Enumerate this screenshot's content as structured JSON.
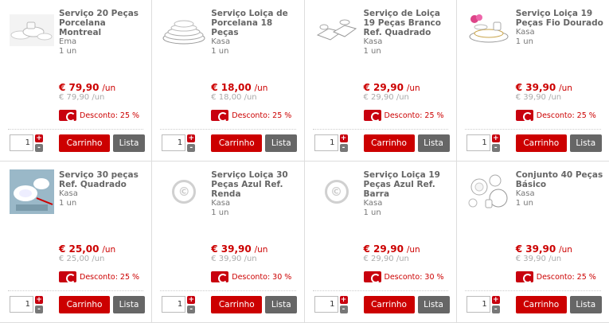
{
  "products": [
    {
      "name": "Serviço 20 Peças Porcelana Montreal",
      "brand": "Ema",
      "unit": "1 un",
      "price": "€ 79,90",
      "price_unit": "/un",
      "old_price": "€ 79,90 /un",
      "discount": "Desconto: 25 %",
      "qty": "1",
      "cart_label": "Carrinho",
      "list_label": "Lista",
      "image": "dish-set"
    },
    {
      "name": "Serviço Loiça de Porcelana 18 Peças",
      "brand": "Kasa",
      "unit": "1 un",
      "price": "€ 18,00",
      "price_unit": "/un",
      "old_price": "€ 18,00 /un",
      "discount": "Desconto: 25 %",
      "qty": "1",
      "cart_label": "Carrinho",
      "list_label": "Lista",
      "image": "plate-stack"
    },
    {
      "name": "Serviço de Loiça 19 Peças Branco Ref. Quadrado",
      "brand": "Kasa",
      "unit": "1 un",
      "price": "€ 29,90",
      "price_unit": "/un",
      "old_price": "€ 29,90 /un",
      "discount": "Desconto: 25 %",
      "qty": "1",
      "cart_label": "Carrinho",
      "list_label": "Lista",
      "image": "square-dishes"
    },
    {
      "name": "Serviço Loiça 19 Peças Fio Dourado",
      "brand": "Kasa",
      "unit": "1 un",
      "price": "€ 39,90",
      "price_unit": "/un",
      "old_price": "€ 39,90 /un",
      "discount": "Desconto: 25 %",
      "qty": "1",
      "cart_label": "Carrinho",
      "list_label": "Lista",
      "image": "gold-dishes"
    },
    {
      "name": "Serviço 30 peças Ref. Quadrado",
      "brand": "Kasa",
      "unit": "1 un",
      "price": "€ 25,00",
      "price_unit": "/un",
      "old_price": "€ 25,00 /un",
      "discount": "Desconto: 25 %",
      "qty": "1",
      "cart_label": "Carrinho",
      "list_label": "Lista",
      "image": "blue-table"
    },
    {
      "name": "Serviço Loiça 30 Peças Azul Ref. Renda",
      "brand": "Kasa",
      "unit": "1 un",
      "price": "€ 39,90",
      "price_unit": "/un",
      "old_price": "€ 39,90 /un",
      "discount": "Desconto: 30 %",
      "qty": "1",
      "cart_label": "Carrinho",
      "list_label": "Lista",
      "image": "placeholder"
    },
    {
      "name": "Serviço Loiça 19 Peças Azul Ref. Barra",
      "brand": "Kasa",
      "unit": "1 un",
      "price": "€ 29,90",
      "price_unit": "/un",
      "old_price": "€ 29,90 /un",
      "discount": "Desconto: 30 %",
      "qty": "1",
      "cart_label": "Carrinho",
      "list_label": "Lista",
      "image": "placeholder"
    },
    {
      "name": "Conjunto 40 Peças Básico",
      "brand": "Kasa",
      "unit": "1 un",
      "price": "€ 39,90",
      "price_unit": "/un",
      "old_price": "€ 39,90 /un",
      "discount": "Desconto: 25 %",
      "qty": "1",
      "cart_label": "Carrinho",
      "list_label": "Lista",
      "image": "basic-set"
    }
  ],
  "placeholder_glyph": "©",
  "stepper": {
    "plus": "+",
    "minus": "-"
  },
  "colors": {
    "accent": "#c00000",
    "button_secondary": "#666666"
  }
}
